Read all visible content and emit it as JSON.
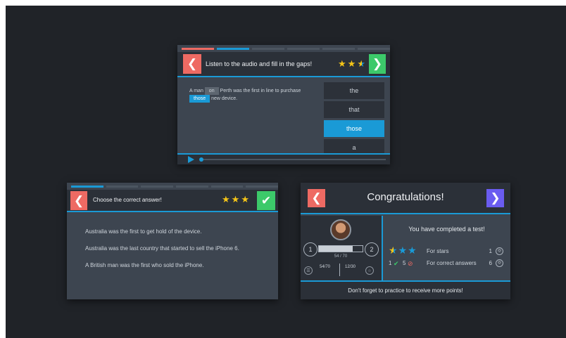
{
  "colors": {
    "background": "#202328",
    "card": "#3d4550",
    "accent": "#1a9ad6",
    "back": "#ee6a63",
    "confirm": "#3cc96a",
    "forward": "#6a5cf0",
    "star": "#f5c518"
  },
  "card1": {
    "title": "Listen to the audio and fill in the gaps!",
    "stars": 2.5,
    "sentence": {
      "part1": "A man ",
      "gap1": "on",
      "part2": " Perth was the first in line to purchase ",
      "gap2": "those",
      "part3": " new device."
    },
    "options": [
      "the",
      "that",
      "those",
      "a"
    ],
    "selected_option": "those",
    "audio_progress": 0
  },
  "card2": {
    "title": "Choose the correct answer!",
    "stars": 3,
    "answers": [
      "Australia was the first to get hold of the device.",
      "Australia was the last country that started to sell the iPhone 6.",
      "A British man was the first who sold the iPhone."
    ]
  },
  "card3": {
    "title": "Congratulations!",
    "subtitle": "You have completed a test!",
    "level_from": "1",
    "level_to": "2",
    "xp_text": "54 / 70",
    "xp_fraction": 0.77,
    "stat_left": "54/70",
    "stat_right": "12/30",
    "stars_label": "For stars",
    "stars_count": "1",
    "correct_label": "For correct answers",
    "correct_count": "6",
    "correct_num": "1",
    "wrong_num": "5",
    "footer": "Don't forget to practice to receive more points!"
  }
}
